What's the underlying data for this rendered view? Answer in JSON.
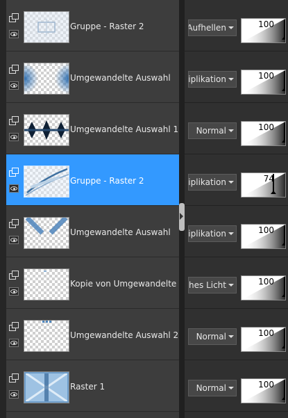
{
  "layers": [
    {
      "name": "Gruppe - Raster 2",
      "blend_mode": "Aufhellen",
      "opacity": 100,
      "selected": false,
      "thumb": "pale-frame"
    },
    {
      "name": "Umgewandelte Auswahl",
      "blend_mode": "Multiplikation",
      "opacity": 100,
      "selected": false,
      "thumb": "blue-edges"
    },
    {
      "name": "Umgewandelte Auswahl 1",
      "blend_mode": "Normal",
      "opacity": 100,
      "selected": false,
      "thumb": "dark-diamonds"
    },
    {
      "name": "Gruppe - Raster 2",
      "blend_mode": "Multiplikation",
      "opacity": 74,
      "selected": true,
      "thumb": "curve-lines"
    },
    {
      "name": "Umgewandelte Auswahl",
      "blend_mode": "Multiplikation",
      "opacity": 100,
      "selected": false,
      "thumb": "blue-v"
    },
    {
      "name": "Kopie von Umgewandelte Auswahl",
      "blend_mode": "Weiches Licht",
      "opacity": 100,
      "selected": false,
      "thumb": "tiny-dot"
    },
    {
      "name": "Umgewandelte Auswahl 2",
      "blend_mode": "Normal",
      "opacity": 100,
      "selected": false,
      "thumb": "top-dots"
    },
    {
      "name": "Raster 1",
      "blend_mode": "Normal",
      "opacity": 100,
      "selected": false,
      "thumb": "blue-x"
    }
  ],
  "colors": {
    "selected_row": "#3399ff",
    "row_bg": "#3d3d3d",
    "panel_bg": "#2f2f2f",
    "accent_blue": "#5b8fc7"
  },
  "icons": {
    "layer_group": "layers-icon",
    "visibility": "eye-icon",
    "dropdown": "chevron-down-icon",
    "splitter": "splitter-arrow-icon"
  }
}
